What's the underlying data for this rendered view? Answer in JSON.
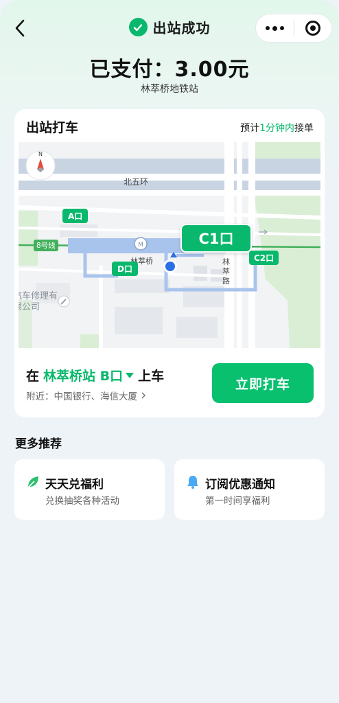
{
  "header": {
    "title": "出站成功",
    "back_icon": "chevron-left-icon",
    "status_icon": "check-circle-icon",
    "accent": "#09b86c"
  },
  "payment": {
    "paid_text": "已支付：3.00元",
    "station": "林萃桥地铁站"
  },
  "taxi_card": {
    "title": "出站打车",
    "eta_prefix": "预计",
    "eta_highlight": "1分钟内",
    "eta_suffix": "接单",
    "map": {
      "road_label": "北五环",
      "line_label": "8号线",
      "station_label": "林萃桥",
      "street_label": "林萃路",
      "exits": [
        "A口",
        "D口",
        "C1口",
        "C2口"
      ],
      "poi_partial": "汽车修理有限公司"
    },
    "pickup_prefix": "在",
    "pickup_station": "林萃桥站 B口",
    "pickup_suffix": "上车",
    "nearby": "附近：中国银行、海信大厦",
    "cta_label": "立即打车"
  },
  "recommend": {
    "title": "更多推荐",
    "items": [
      {
        "title": "天天兑福利",
        "subtitle": "兑换抽奖各种活动",
        "icon": "leaf-icon",
        "color": "#2dbf6e"
      },
      {
        "title": "订阅优惠通知",
        "subtitle": "第一时间享福利",
        "icon": "bell-icon",
        "color": "#4aa9f5"
      }
    ]
  }
}
